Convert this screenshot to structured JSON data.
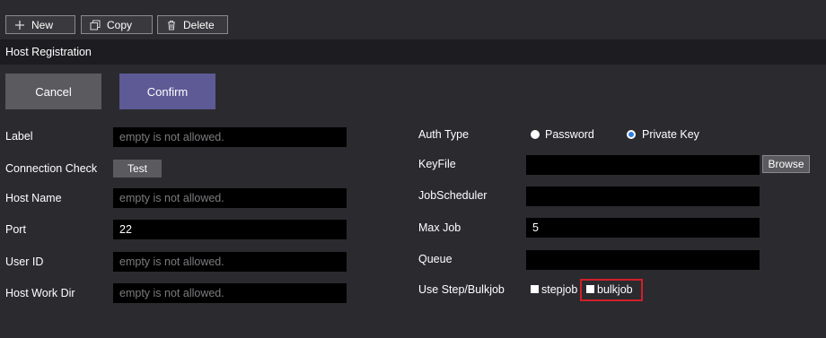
{
  "toolbar": {
    "new_label": "New",
    "copy_label": "Copy",
    "delete_label": "Delete"
  },
  "section": {
    "title": "Host Registration"
  },
  "actions": {
    "cancel": "Cancel",
    "confirm": "Confirm"
  },
  "left_form": {
    "label": {
      "label": "Label",
      "placeholder": "empty is not allowed."
    },
    "connection_check": {
      "label": "Connection Check",
      "button": "Test"
    },
    "host_name": {
      "label": "Host Name",
      "placeholder": "empty is not allowed."
    },
    "port": {
      "label": "Port",
      "value": "22"
    },
    "user_id": {
      "label": "User ID",
      "placeholder": "empty is not allowed."
    },
    "host_work_dir": {
      "label": "Host Work Dir",
      "placeholder": "empty is not allowed."
    }
  },
  "right_form": {
    "auth_type": {
      "label": "Auth Type",
      "option_password": "Password",
      "option_private_key": "Private Key",
      "selected": "Private Key"
    },
    "keyfile": {
      "label": "KeyFile",
      "value": "",
      "browse": "Browse"
    },
    "jobscheduler": {
      "label": "JobScheduler",
      "value": ""
    },
    "max_job": {
      "label": "Max Job",
      "value": "5"
    },
    "queue": {
      "label": "Queue",
      "value": ""
    },
    "use_step_bulkjob": {
      "label": "Use Step/Bulkjob",
      "stepjob": "stepjob",
      "bulkjob": "bulkjob",
      "stepjob_checked": false,
      "bulkjob_checked": false
    }
  },
  "colors": {
    "background": "#2b2a2f",
    "section_bar": "#1d1d21",
    "confirm_button": "#5d5a96",
    "cancel_button": "#5b5b5f",
    "radio_selected": "#2f7de1",
    "highlight_border": "#d0202a"
  },
  "icons": {
    "new": "plus-icon",
    "copy": "copy-icon",
    "delete": "trash-icon"
  }
}
